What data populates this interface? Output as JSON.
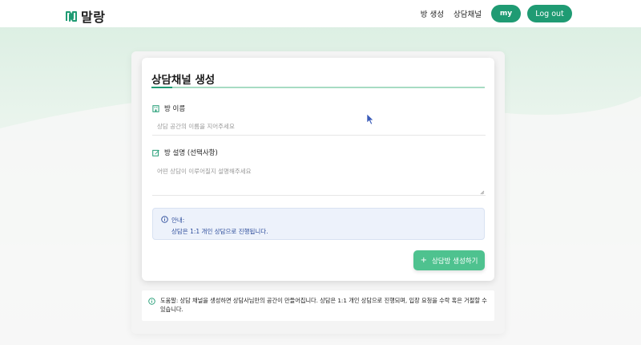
{
  "brand": {
    "name": "말랑",
    "accent": "#1f9b73",
    "logo_icon": "n-logo-icon"
  },
  "nav": {
    "links": [
      "방 생성",
      "상담채널"
    ],
    "my_label": "my",
    "logout_label": "Log out"
  },
  "form": {
    "title": "상담채널 생성",
    "name_field": {
      "label": "방 이름",
      "icon": "building-icon",
      "placeholder": "상담 공간의 이름을 지어주세요"
    },
    "desc_field": {
      "label": "방 설명 (선택사항)",
      "icon": "edit-icon",
      "placeholder": "어떤 상담이 이루어질지 설명해주세요"
    },
    "notice": {
      "icon": "info-icon",
      "title": "안내:",
      "text": "상담은 1:1 개인 상담으로 진행됩니다."
    },
    "submit_label": "상담방 생성하기",
    "submit_icon": "plus-icon"
  },
  "help": {
    "icon": "info-icon",
    "text": "도움말: 상담 채널을 생성하면 상담사님만의 공간이 만들어집니다. 상담은 1:1 개인 상담으로 진행되며, 입장 요청을 수락 혹은 거절할 수 있습니다."
  }
}
